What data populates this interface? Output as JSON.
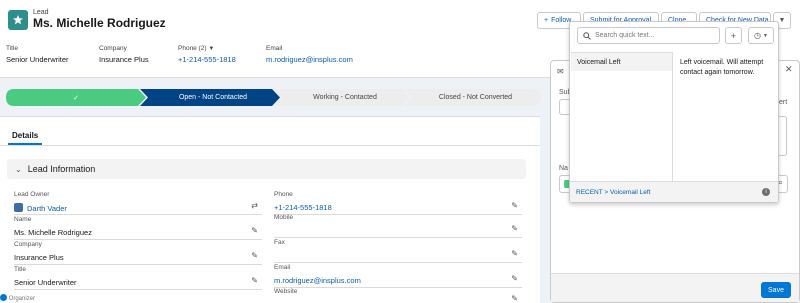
{
  "header": {
    "object_label": "Lead",
    "record_name": "Ms. Michelle Rodriguez",
    "actions": [
      "Follow",
      "Submit for Approval",
      "Clone",
      "Check for New Data"
    ]
  },
  "highlights": [
    {
      "label": "Title",
      "value": "Senior Underwriter"
    },
    {
      "label": "Company",
      "value": "Insurance Plus"
    },
    {
      "label": "Phone (2)",
      "value": "+1-214-555-1818"
    },
    {
      "label": "Email",
      "value": "m.rodriguez@insplus.com"
    }
  ],
  "path": {
    "stages": [
      "Open - Not Contacted",
      "Working - Contacted",
      "Closed - Not Converted"
    ],
    "complete_marker": "✓"
  },
  "details": {
    "tab": "Details",
    "section": "Lead Information",
    "left": [
      {
        "label": "Lead Owner",
        "value": "Darth Vader"
      },
      {
        "label": "Name",
        "value": "Ms. Michelle Rodriguez"
      },
      {
        "label": "Company",
        "value": "Insurance Plus"
      },
      {
        "label": "Title",
        "value": "Senior Underwriter"
      }
    ],
    "right": [
      {
        "label": "Phone",
        "value": "+1-214-555-1818"
      },
      {
        "label": "Mobile",
        "value": ""
      },
      {
        "label": "Fax",
        "value": ""
      },
      {
        "label": "Email",
        "value": "m.rodriguez@insplus.com"
      },
      {
        "label": "Website",
        "value": ""
      }
    ]
  },
  "panel": {
    "save_label": "Save",
    "partial": [
      "Sub",
      "Na",
      "ert"
    ]
  },
  "quick_text": {
    "placeholder": "Search quick text...",
    "add": "+",
    "items": [
      "Voicemail Left"
    ],
    "preview": "Left voicemail. Will attempt contact again tomorrow.",
    "breadcrumb": "RECENT > Voicemail Left",
    "info": "i"
  },
  "footer": {
    "organizer": "Organizer"
  },
  "colors": {
    "brand": "#0176d3",
    "complete": "#4bca81",
    "current": "#014486",
    "lead_icon": "#2e8e8c"
  }
}
